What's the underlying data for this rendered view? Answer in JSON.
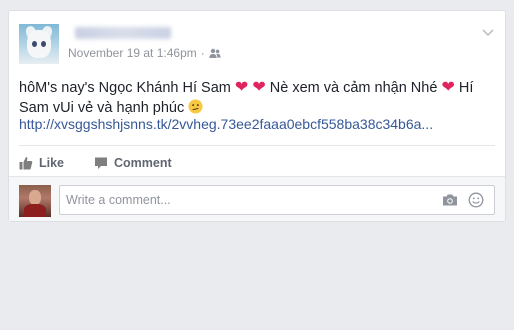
{
  "post": {
    "timestamp": "November 19 at 1:46pm",
    "separator": "·",
    "audience_icon": "friends-icon",
    "text_part1": "hôM's nay's Ngọc Khánh Hí Sam ",
    "text_part2": " Nè xem và cảm nhận Nhé ",
    "text_part3": " Hí Sam vUi vẻ và hạnh phúc ",
    "heart_glyph": "❤",
    "link": "http://xvsggshshjsnns.tk/2vvheg.73ee2faaa0ebcf558ba38c34b6a..."
  },
  "actions": {
    "like_label": "Like",
    "comment_label": "Comment"
  },
  "comment_box": {
    "placeholder": "Write a comment...",
    "camera_icon": "camera-icon",
    "emoji_icon": "emoji-icon"
  },
  "colors": {
    "link": "#365899",
    "meta": "#90949c",
    "heart": "#e0245e",
    "background": "#e9ebee"
  }
}
